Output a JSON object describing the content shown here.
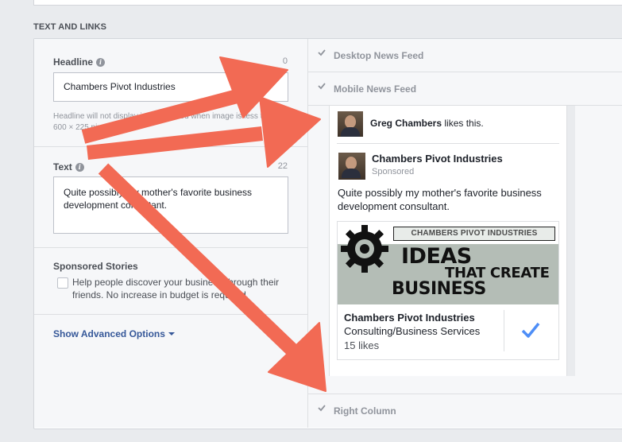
{
  "section_title": "TEXT AND LINKS",
  "headline": {
    "label": "Headline",
    "counter": "0",
    "value": "Chambers Pivot Industries",
    "help": "Headline will not display in News Feed when image is less than 600 × 225 pixels"
  },
  "text": {
    "label": "Text",
    "counter": "22",
    "value": "Quite possibly my mother's favorite business development consultant."
  },
  "sponsored_stories": {
    "label": "Sponsored Stories",
    "checkbox_label": "Help people discover your business through their friends. No increase in budget is required."
  },
  "advanced_options_label": "Show Advanced Options",
  "placements": {
    "desktop": "Desktop News Feed",
    "mobile": "Mobile News Feed",
    "right": "Right Column"
  },
  "preview": {
    "liker_name": "Greg Chambers",
    "likes_suffix": " likes this.",
    "page_name": "Chambers Pivot Industries",
    "sponsored": "Sponsored",
    "post_text": "Quite possibly my mother's favorite business development consultant.",
    "banner": {
      "top": "CHAMBERS PIVOT INDUSTRIES",
      "line1": "IDEAS",
      "line2": "THAT CREATE",
      "line3": "BUSINESS"
    },
    "card_title": "Chambers Pivot Industries",
    "card_category": "Consulting/Business Services",
    "card_likes": "15 likes"
  },
  "colors": {
    "arrow": "#f26a54",
    "link": "#365899",
    "like_check": "#4e8ef7"
  },
  "icons": [
    "info-icon",
    "checkmark-icon",
    "caret-down-icon",
    "gear-icon",
    "like-check-icon"
  ]
}
